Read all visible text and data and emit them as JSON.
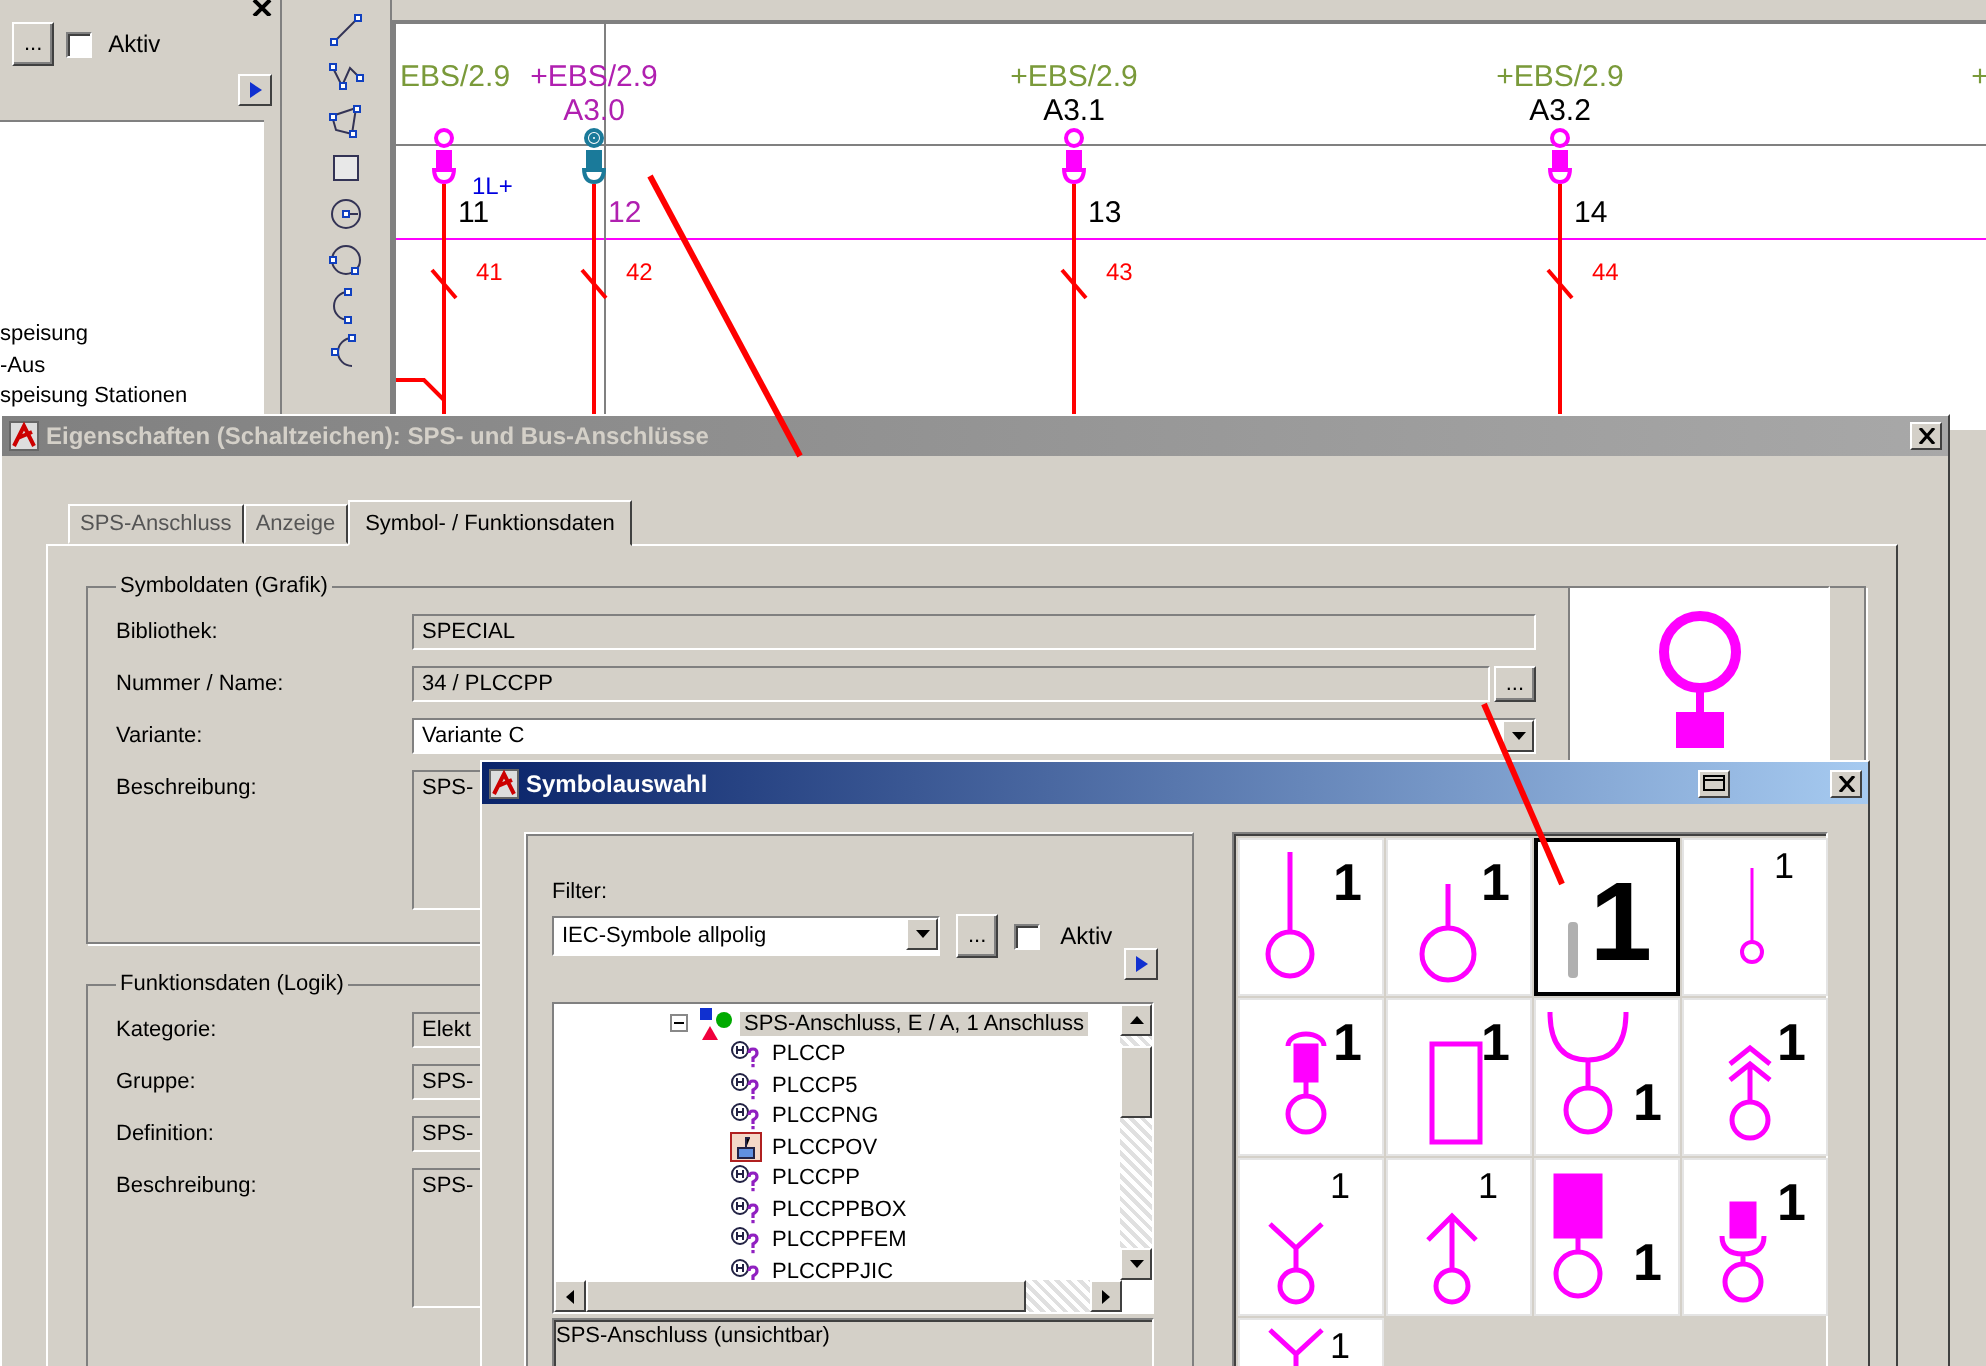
{
  "side_panel": {
    "browse_button": "...",
    "active_checkbox": {
      "label": "Aktiv",
      "checked": false
    },
    "list_items": [
      "speisung",
      "-Aus",
      "speisung Stationen"
    ]
  },
  "canvas": {
    "columns": [
      {
        "location": "EBS/2.9",
        "terminal": "11",
        "wire": "41",
        "signal": "1L+",
        "selected": false
      },
      {
        "location": "+EBS/2.9",
        "device": "A3.0",
        "terminal": "12",
        "wire": "42",
        "selected": true
      },
      {
        "location": "+EBS/2.9",
        "device": "A3.1",
        "terminal": "13",
        "wire": "43",
        "selected": false
      },
      {
        "location": "+EBS/2.9",
        "device": "A3.2",
        "terminal": "14",
        "wire": "44",
        "selected": false
      },
      {
        "location": "+",
        "selected": false
      }
    ]
  },
  "properties_dialog": {
    "title": "Eigenschaften (Schaltzeichen): SPS- und Bus-Anschlüsse",
    "active": false,
    "tabs": [
      {
        "label": "SPS-Anschluss",
        "selected": false
      },
      {
        "label": "Anzeige",
        "selected": false
      },
      {
        "label": "Symbol- / Funktionsdaten",
        "selected": true
      }
    ],
    "symbol_group": {
      "title": "Symboldaten (Grafik)",
      "fields": [
        {
          "label": "Bibliothek:",
          "value": "SPECIAL",
          "kind": "readonly"
        },
        {
          "label": "Nummer / Name:",
          "value": "34 / PLCCPP",
          "kind": "browse",
          "button": "..."
        },
        {
          "label": "Variante:",
          "value": "Variante C",
          "kind": "dropdown"
        },
        {
          "label": "Beschreibung:",
          "value": "SPS-",
          "kind": "multiline"
        }
      ]
    },
    "function_group": {
      "title": "Funktionsdaten (Logik)",
      "fields": [
        {
          "label": "Kategorie:",
          "value": "Elekt",
          "kind": "readonly"
        },
        {
          "label": "Gruppe:",
          "value": "SPS-",
          "kind": "readonly"
        },
        {
          "label": "Definition:",
          "value": "SPS-",
          "kind": "readonly"
        },
        {
          "label": "Beschreibung:",
          "value": "SPS-",
          "kind": "multiline"
        }
      ]
    }
  },
  "symbol_dialog": {
    "title": "Symbolauswahl",
    "active": true,
    "filter": {
      "label": "Filter:",
      "value": "IEC-Symbole allpolig",
      "button": "...",
      "active_checkbox": {
        "label": "Aktiv",
        "checked": false
      }
    },
    "tree": [
      {
        "label": "SPS-Anschluss, E / A, 1 Anschluss",
        "kind": "group",
        "expanded": true,
        "selected": true,
        "children": [
          {
            "label": "PLCCP",
            "kind": "unknown",
            "selected": false
          },
          {
            "label": "PLCCP5",
            "kind": "unknown",
            "selected": false
          },
          {
            "label": "PLCCPNG",
            "kind": "unknown",
            "selected": false
          },
          {
            "label": "PLCCPOV",
            "kind": "symbol",
            "selected": false
          },
          {
            "label": "PLCCPP",
            "kind": "unknown",
            "selected": false
          },
          {
            "label": "PLCCPPBOX",
            "kind": "unknown",
            "selected": false
          },
          {
            "label": "PLCCPPFEM",
            "kind": "unknown",
            "selected": false
          },
          {
            "label": "PLCCPPJIC",
            "kind": "unknown",
            "selected": false
          }
        ]
      }
    ],
    "description": "SPS-Anschluss (unsichtbar)",
    "symbols": [
      {
        "kind": "pin-circle",
        "label": "1",
        "selected": false
      },
      {
        "kind": "short-pin-circle",
        "label": "1",
        "selected": false
      },
      {
        "kind": "bar",
        "label": "1",
        "selected": true
      },
      {
        "kind": "thin-pin",
        "label": "1",
        "selected": false
      },
      {
        "kind": "cap-block",
        "label": "1",
        "selected": false
      },
      {
        "kind": "rectangle",
        "label": "1",
        "selected": false
      },
      {
        "kind": "cup",
        "label": "1",
        "selected": false
      },
      {
        "kind": "chevron",
        "label": "1",
        "selected": false
      },
      {
        "kind": "fork",
        "label": "1",
        "selected": false
      },
      {
        "kind": "arrow",
        "label": "1",
        "selected": false
      },
      {
        "kind": "block",
        "label": "1",
        "selected": false
      },
      {
        "kind": "block-cup",
        "label": "1",
        "selected": false
      },
      {
        "kind": "fork-high",
        "label": "1",
        "selected": false
      }
    ]
  }
}
